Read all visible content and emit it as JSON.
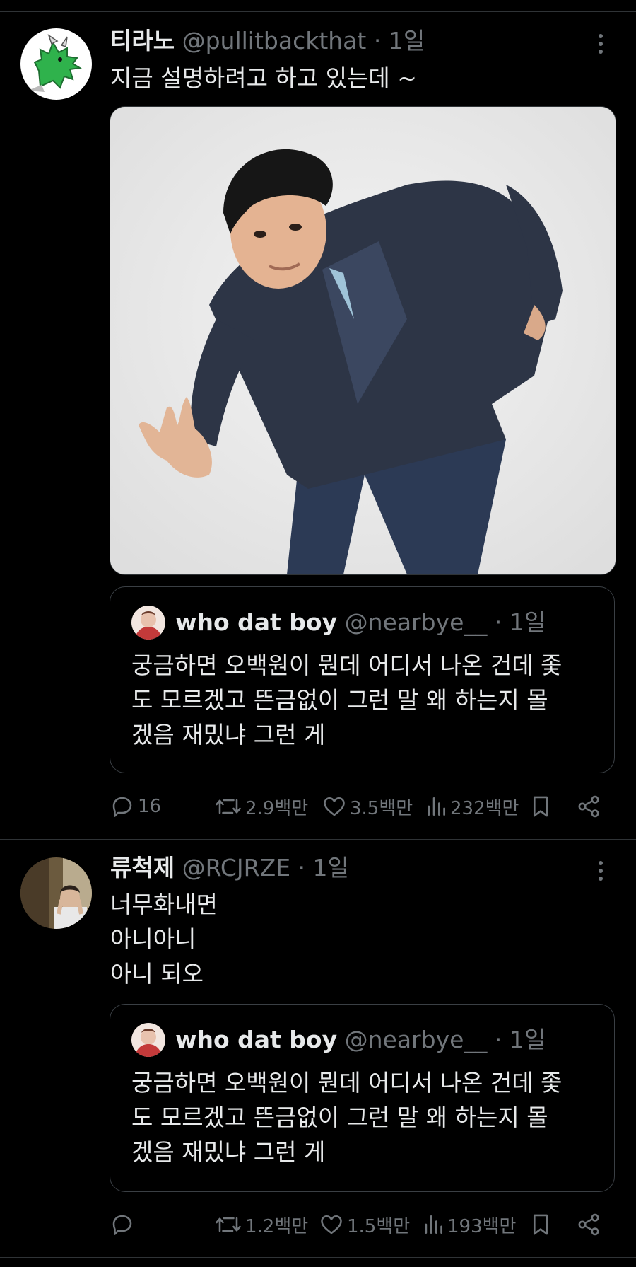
{
  "tweets": [
    {
      "name": "티라노",
      "handle": "@pullitbackthat",
      "sep": "·",
      "time": "1일",
      "lines": [
        "지금 설명하려고 하고 있는데 ~"
      ],
      "avatar_icon": "green-dinosaur-icon",
      "media_description_icon": "photo",
      "quote": {
        "name": "who dat boy",
        "handle": "@nearbye__",
        "sep": "·",
        "time": "1일",
        "lines": [
          "궁금하면 오백원이 뭔데 어디서 나온 건데 좇",
          "도 모르겠고 뜬금없이 그런 말 왜 하는지 몰",
          "겠음 재밌냐 그런 게"
        ]
      },
      "stats": {
        "replies": "16",
        "retweets": "2.9백만",
        "likes": "3.5백만",
        "views": "232백만"
      }
    },
    {
      "name": "류척제",
      "handle": "@RCJRZE",
      "sep": "·",
      "time": "1일",
      "lines": [
        "너무화내면",
        "아니아니",
        "아니 되오"
      ],
      "quote": {
        "name": "who dat boy",
        "handle": "@nearbye__",
        "sep": "·",
        "time": "1일",
        "lines": [
          "궁금하면 오백원이 뭔데 어디서 나온 건데 좇",
          "도 모르겠고 뜬금없이 그런 말 왜 하는지 몰",
          "겠음 재밌냐 그런 게"
        ]
      },
      "stats": {
        "replies": "",
        "retweets": "1.2백만",
        "likes": "1.5백만",
        "views": "193백만"
      }
    }
  ],
  "colors": {
    "background": "#000000",
    "text": "#e7e9ea",
    "muted": "#71767b",
    "border": "#2f3336",
    "dino": "#2fb24c"
  }
}
